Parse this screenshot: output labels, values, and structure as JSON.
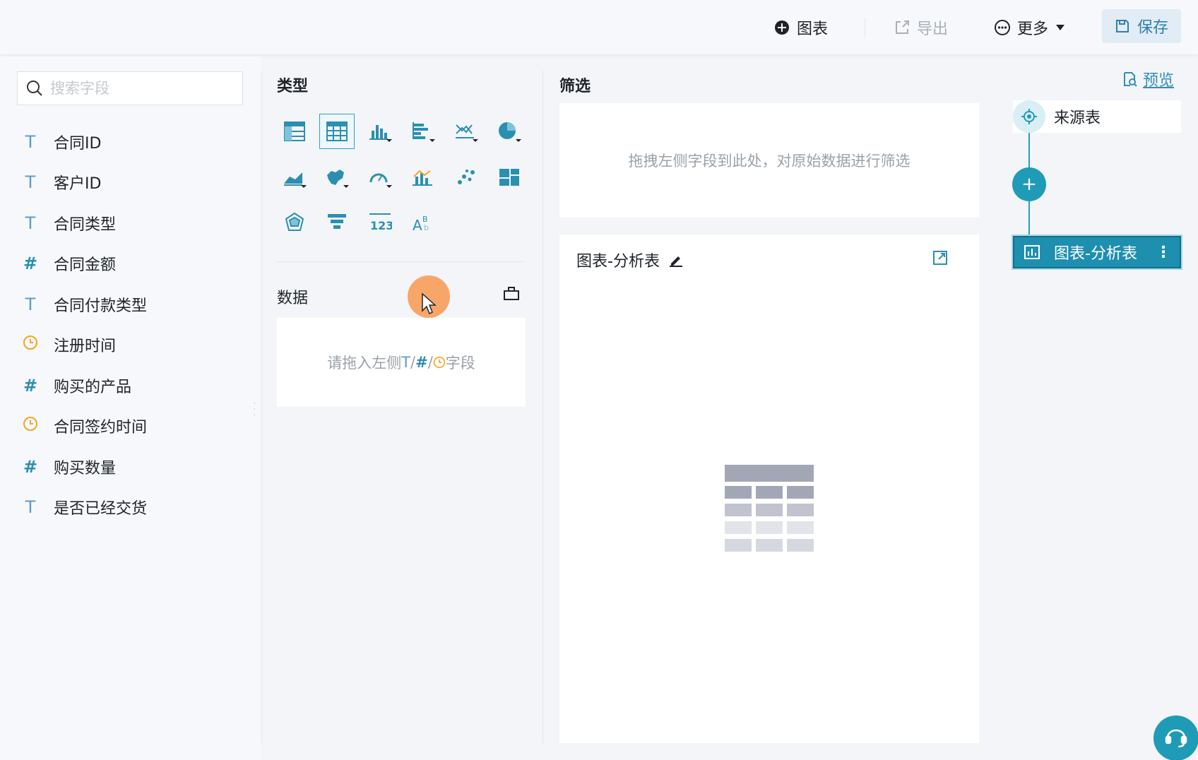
{
  "toolbar": {
    "add_chart_label": "图表",
    "export_label": "导出",
    "more_label": "更多",
    "save_label": "保存"
  },
  "fields_panel": {
    "search_placeholder": "搜索字段",
    "fields": [
      {
        "type": "T",
        "name": "合同ID"
      },
      {
        "type": "T",
        "name": "客户ID"
      },
      {
        "type": "T",
        "name": "合同类型"
      },
      {
        "type": "#",
        "name": "合同金额"
      },
      {
        "type": "T",
        "name": "合同付款类型"
      },
      {
        "type": "date",
        "name": "注册时间"
      },
      {
        "type": "#",
        "name": "购买的产品"
      },
      {
        "type": "date",
        "name": "合同签约时间"
      },
      {
        "type": "#",
        "name": "购买数量"
      },
      {
        "type": "T",
        "name": "是否已经交货"
      }
    ]
  },
  "config_panel": {
    "type_title": "类型",
    "data_title": "数据",
    "data_drop_prefix": "请拖入左侧",
    "data_drop_t": "T",
    "data_drop_slash": "/",
    "data_drop_hash": "#",
    "data_drop_suffix": "字段",
    "chart_types": [
      "group-table",
      "detail-table",
      "bar-chart",
      "horizontal-bar-chart",
      "line-chart",
      "pie-chart",
      "area-chart",
      "map-chart",
      "gauge-chart",
      "combo-chart",
      "scatter-chart",
      "treemap-chart",
      "radar-chart",
      "funnel-chart",
      "kpi-card",
      "word-cloud"
    ],
    "selected_chart_type": "detail-table"
  },
  "filter_panel": {
    "title": "筛选",
    "placeholder": "拖拽左侧字段到此处，对原始数据进行筛选"
  },
  "preview": {
    "title": "图表-分析表"
  },
  "flow": {
    "preview_link": "预览",
    "source_node": "来源表",
    "chart_node": "图表-分析表"
  },
  "colors": {
    "accent": "#1f9bb7",
    "number_field": "#2b8fb0",
    "text_field": "#5d9cc8",
    "date_field": "#f4a623"
  }
}
